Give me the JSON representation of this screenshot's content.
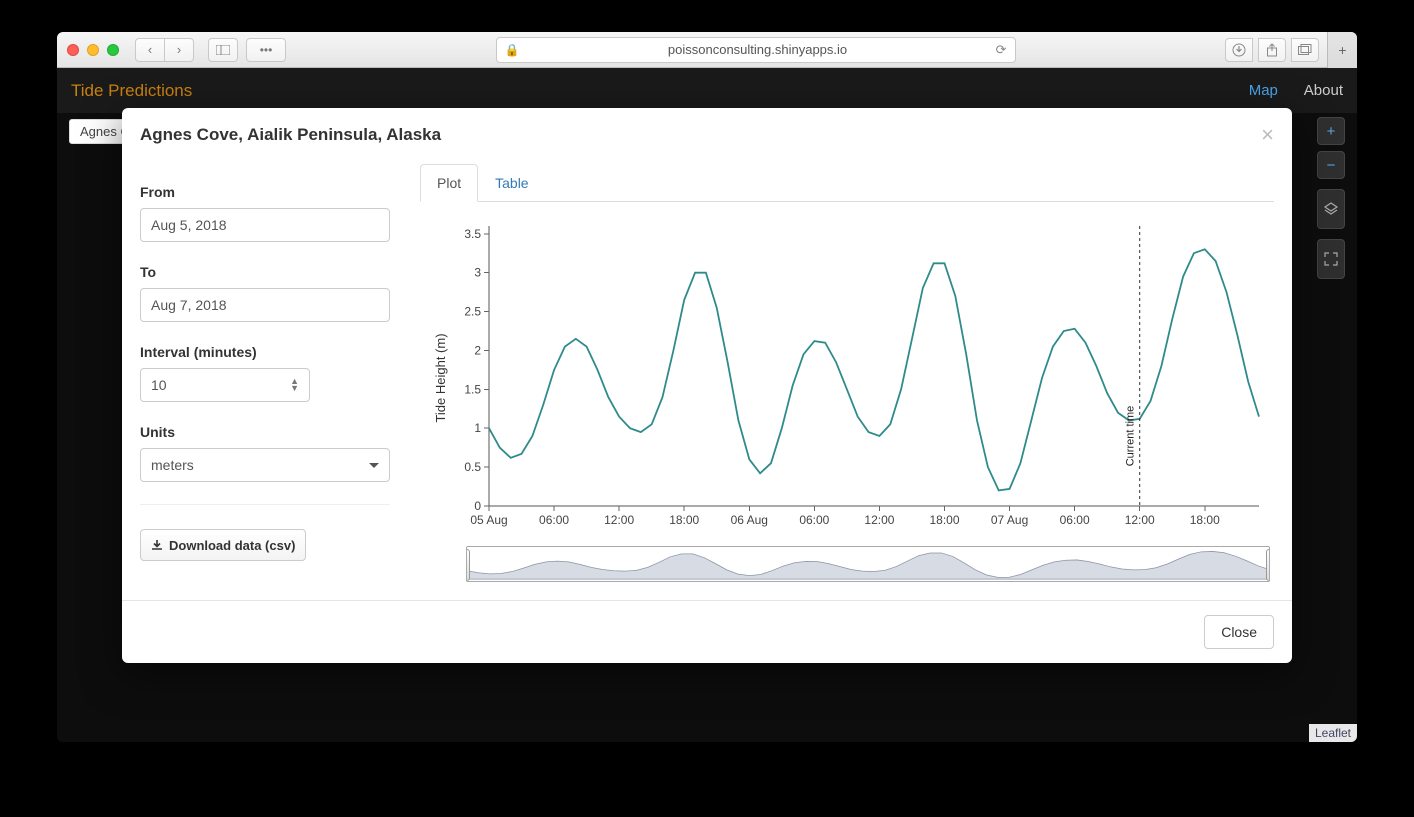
{
  "browser": {
    "url_host": "poissonconsulting.shinyapps.io"
  },
  "app": {
    "title": "Tide Predictions",
    "nav": {
      "map": "Map",
      "about": "About"
    },
    "map_chip": "Agnes Co",
    "zoom_plus": "+",
    "zoom_minus": "−",
    "attribution": "Leaflet"
  },
  "modal": {
    "title": "Agnes Cove, Aialik Peninsula, Alaska",
    "close_label": "Close",
    "form": {
      "from_label": "From",
      "from_value": "Aug 5, 2018",
      "to_label": "To",
      "to_value": "Aug 7, 2018",
      "interval_label": "Interval (minutes)",
      "interval_value": "10",
      "units_label": "Units",
      "units_value": "meters",
      "download_label": "Download data (csv)"
    },
    "tabs": {
      "plot": "Plot",
      "table": "Table"
    },
    "chart": {
      "ylabel": "Tide Height (m)",
      "current_time_label": "Current time"
    }
  },
  "chart_data": {
    "type": "line",
    "title": "",
    "xlabel": "",
    "ylabel": "Tide Height (m)",
    "ylim": [
      0,
      3.6
    ],
    "y_ticks": [
      0,
      0.5,
      1,
      1.5,
      2,
      2.5,
      3,
      3.5
    ],
    "x_categories": [
      "05 Aug",
      "06:00",
      "12:00",
      "18:00",
      "06 Aug",
      "06:00",
      "12:00",
      "18:00",
      "07 Aug",
      "06:00",
      "12:00",
      "18:00"
    ],
    "current_time_x_index": 10,
    "series": [
      {
        "name": "Tide Height",
        "x_hours": [
          0,
          1,
          2,
          3,
          4,
          5,
          6,
          7,
          8,
          9,
          10,
          11,
          12,
          13,
          14,
          15,
          16,
          17,
          18,
          19,
          20,
          21,
          22,
          23,
          24,
          25,
          26,
          27,
          28,
          29,
          30,
          31,
          32,
          33,
          34,
          35,
          36,
          37,
          38,
          39,
          40,
          41,
          42,
          43,
          44,
          45,
          46,
          47,
          48,
          49,
          50,
          51,
          52,
          53,
          54,
          55,
          56,
          57,
          58,
          59,
          60,
          61,
          62,
          63,
          64,
          65,
          66,
          67,
          68,
          69,
          70,
          71
        ],
        "y": [
          1.0,
          0.75,
          0.62,
          0.67,
          0.9,
          1.3,
          1.75,
          2.05,
          2.15,
          2.05,
          1.75,
          1.4,
          1.15,
          1.0,
          0.95,
          1.05,
          1.4,
          2.0,
          2.65,
          3.0,
          3.0,
          2.55,
          1.85,
          1.1,
          0.6,
          0.42,
          0.55,
          1.0,
          1.55,
          1.95,
          2.12,
          2.1,
          1.85,
          1.5,
          1.15,
          0.95,
          0.9,
          1.05,
          1.5,
          2.15,
          2.8,
          3.12,
          3.12,
          2.7,
          1.95,
          1.1,
          0.5,
          0.2,
          0.22,
          0.55,
          1.1,
          1.65,
          2.05,
          2.25,
          2.28,
          2.1,
          1.8,
          1.45,
          1.2,
          1.1,
          1.12,
          1.35,
          1.8,
          2.4,
          2.95,
          3.25,
          3.3,
          3.15,
          2.75,
          2.2,
          1.6,
          1.15
        ]
      }
    ]
  }
}
